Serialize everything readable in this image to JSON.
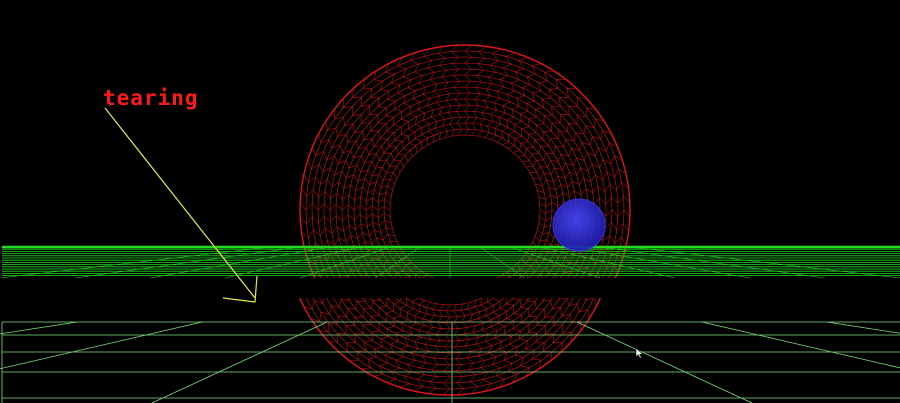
{
  "annotation": {
    "label": "tearing"
  },
  "colors": {
    "background": "#000000",
    "torus_wire": "#e01515",
    "ground_upper": "#22dd22",
    "ground_lower": "#7fe07f",
    "sphere": "#2a2ad8",
    "annotation_text": "#ff1a1a",
    "arrow": "#e8e84a"
  },
  "icons": {
    "cursor": "mouse-pointer-icon"
  }
}
